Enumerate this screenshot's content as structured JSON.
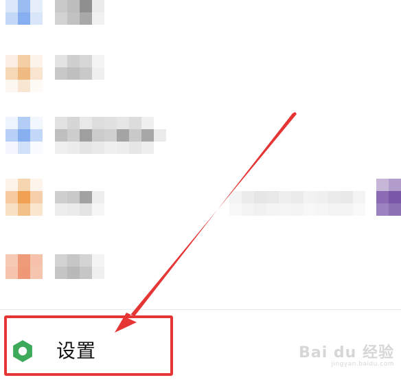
{
  "menu": {
    "settings_label": "设置"
  },
  "annotation": {
    "color": "#e53535"
  },
  "icons": {
    "settings": "gear-icon"
  },
  "colors": {
    "gear": "#3da95b",
    "divider": "#e9e9e9"
  },
  "watermark": {
    "main": "Bai du 经验",
    "sub": "jingyan.baidu.com"
  }
}
